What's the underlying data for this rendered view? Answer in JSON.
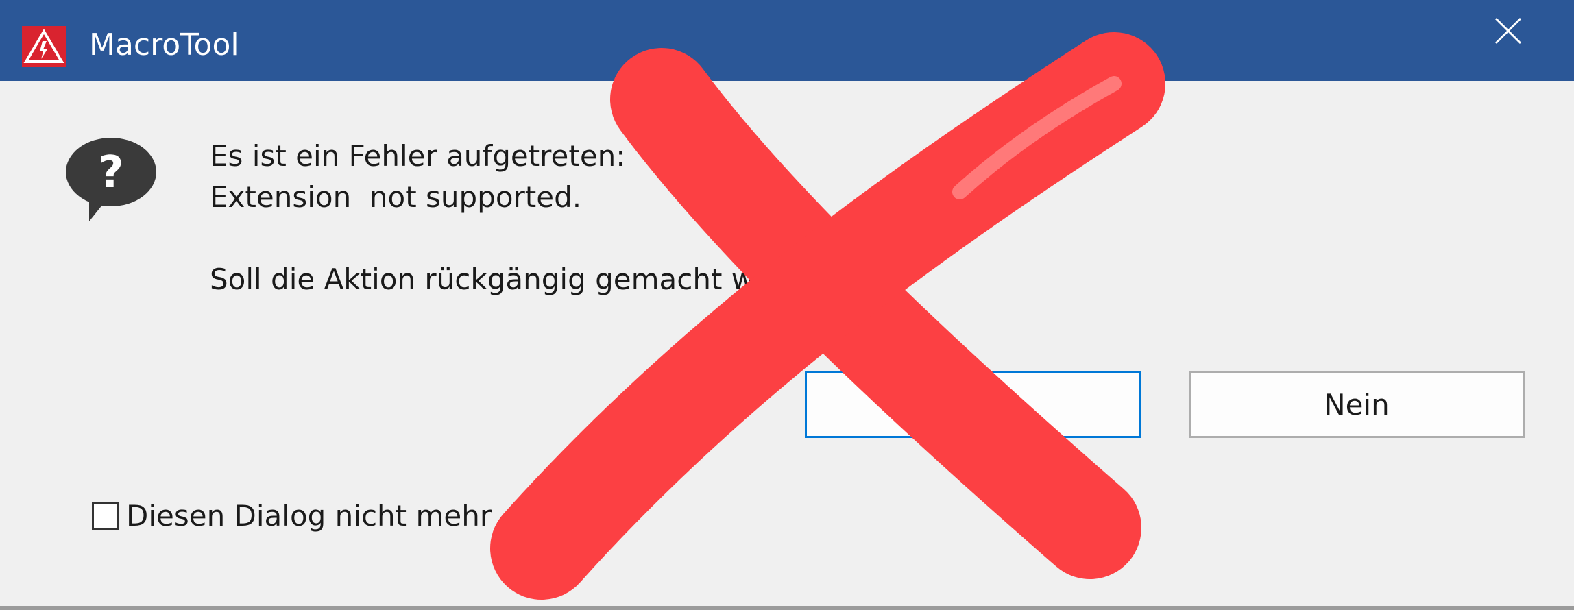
{
  "window": {
    "title": "MacroTool"
  },
  "dialog": {
    "message_line1": "Es ist ein Fehler aufgetreten:",
    "message_line2": "Extension  not supported.",
    "question": "Soll die Aktion rückgängig gemacht w",
    "buttons": {
      "yes_label": "",
      "no_label": "Nein"
    },
    "checkbox_label": "Diesen Dialog nicht mehr",
    "checkbox_checked": false
  },
  "icons": {
    "app": "warning-triangle-icon",
    "question": "question-speech-bubble-icon",
    "close": "close-icon",
    "overlay": "red-cross-overlay"
  },
  "colors": {
    "titlebar": "#2b5797",
    "app_icon": "#d9232f",
    "default_button_border": "#0078d7",
    "cross": "#fc4043"
  }
}
